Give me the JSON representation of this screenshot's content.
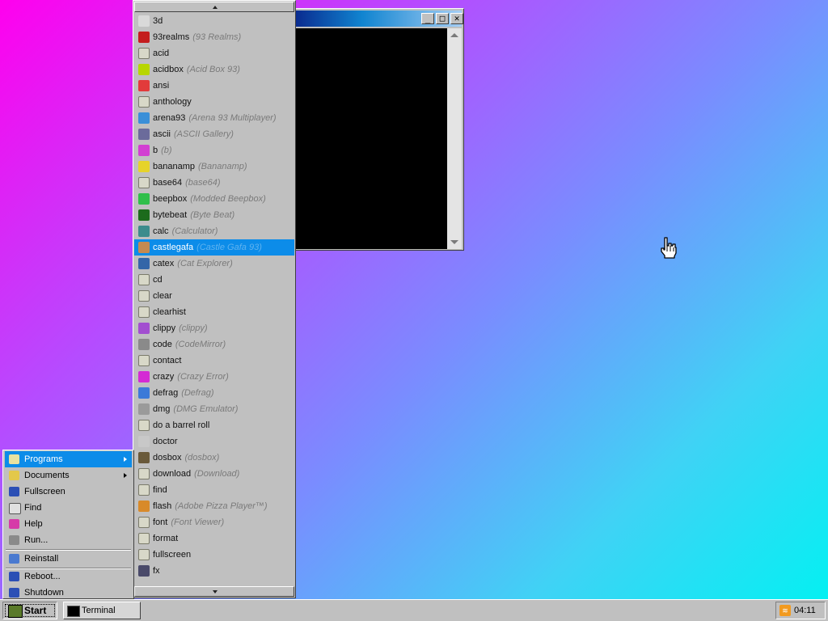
{
  "programs": {
    "selected_index": 14,
    "items": [
      {
        "cmd": "3d",
        "alias": "",
        "icon": "teapot-icon",
        "color": "#d9d9d9"
      },
      {
        "cmd": "93realms",
        "alias": "(93 Realms)",
        "icon": "realms-icon",
        "color": "#c41e1e"
      },
      {
        "cmd": "acid",
        "alias": "",
        "icon": "exe-icon",
        "color": "#d8d8c8"
      },
      {
        "cmd": "acidbox",
        "alias": "(Acid Box 93)",
        "icon": "acid-smiley-icon",
        "color": "#b7d600"
      },
      {
        "cmd": "ansi",
        "alias": "",
        "icon": "ansi-icon",
        "color": "#e23b3b"
      },
      {
        "cmd": "anthology",
        "alias": "",
        "icon": "exe-icon",
        "color": "#d8d8c8"
      },
      {
        "cmd": "arena93",
        "alias": "(Arena 93 Multiplayer)",
        "icon": "cube-icon",
        "color": "#3a8fd8"
      },
      {
        "cmd": "ascii",
        "alias": "(ASCII Gallery)",
        "icon": "ascii-icon",
        "color": "#6b6b9b"
      },
      {
        "cmd": "b",
        "alias": "(b)",
        "icon": "b-icon",
        "color": "#d23fd2"
      },
      {
        "cmd": "bananamp",
        "alias": "(Bananamp)",
        "icon": "banana-icon",
        "color": "#e6d32a"
      },
      {
        "cmd": "base64",
        "alias": "(base64)",
        "icon": "exe-icon",
        "color": "#d8d8c8"
      },
      {
        "cmd": "beepbox",
        "alias": "(Modded Beepbox)",
        "icon": "beepbox-icon",
        "color": "#2fbf4a"
      },
      {
        "cmd": "bytebeat",
        "alias": "(Byte Beat)",
        "icon": "bytebeat-icon",
        "color": "#1c6b1c"
      },
      {
        "cmd": "calc",
        "alias": "(Calculator)",
        "icon": "calculator-icon",
        "color": "#3c8c8c"
      },
      {
        "cmd": "castlegafa",
        "alias": "(Castle Gafa 93)",
        "icon": "castle-character-icon",
        "color": "#c48a52"
      },
      {
        "cmd": "catex",
        "alias": "(Cat Explorer)",
        "icon": "cat-explorer-icon",
        "color": "#3466a8"
      },
      {
        "cmd": "cd",
        "alias": "",
        "icon": "exe-icon",
        "color": "#d8d8c8"
      },
      {
        "cmd": "clear",
        "alias": "",
        "icon": "exe-icon",
        "color": "#d8d8c8"
      },
      {
        "cmd": "clearhist",
        "alias": "",
        "icon": "exe-icon",
        "color": "#d8d8c8"
      },
      {
        "cmd": "clippy",
        "alias": "(clippy)",
        "icon": "clippy-icon",
        "color": "#a24fd0"
      },
      {
        "cmd": "code",
        "alias": "(CodeMirror)",
        "icon": "code-icon",
        "color": "#8a8a8a"
      },
      {
        "cmd": "contact",
        "alias": "",
        "icon": "exe-icon",
        "color": "#d8d8c8"
      },
      {
        "cmd": "crazy",
        "alias": "(Crazy Error)",
        "icon": "error-icon",
        "color": "#d42bd4"
      },
      {
        "cmd": "defrag",
        "alias": "(Defrag)",
        "icon": "defrag-icon",
        "color": "#3c7ad8"
      },
      {
        "cmd": "dmg",
        "alias": "(DMG Emulator)",
        "icon": "gameboy-icon",
        "color": "#9a9a9a"
      },
      {
        "cmd": "do a barrel roll",
        "alias": "",
        "icon": "exe-icon",
        "color": "#d8d8c8"
      },
      {
        "cmd": "doctor",
        "alias": "",
        "icon": "doctor-icon",
        "color": "#c8c8c8"
      },
      {
        "cmd": "dosbox",
        "alias": "(dosbox)",
        "icon": "dosbox-icon",
        "color": "#6a5a3a"
      },
      {
        "cmd": "download",
        "alias": "(Download)",
        "icon": "exe-icon",
        "color": "#d8d8c8"
      },
      {
        "cmd": "find",
        "alias": "",
        "icon": "exe-icon",
        "color": "#d8d8c8"
      },
      {
        "cmd": "flash",
        "alias": "(Adobe Pizza Player™)",
        "icon": "pizza-icon",
        "color": "#d88a2a"
      },
      {
        "cmd": "font",
        "alias": "(Font Viewer)",
        "icon": "exe-icon",
        "color": "#d8d8c8"
      },
      {
        "cmd": "format",
        "alias": "",
        "icon": "exe-icon",
        "color": "#d8d8c8"
      },
      {
        "cmd": "fullscreen",
        "alias": "",
        "icon": "exe-icon",
        "color": "#d8d8c8"
      },
      {
        "cmd": "fx",
        "alias": "",
        "icon": "fx-icon",
        "color": "#4a4a6a"
      }
    ]
  },
  "start_menu": {
    "programs": "Programs",
    "documents": "Documents",
    "fullscreen": "Fullscreen",
    "find": "Find",
    "help": "Help",
    "run": "Run...",
    "reinstall": "Reinstall",
    "reboot": "Reboot...",
    "shutdown": "Shutdown"
  },
  "taskbar": {
    "start_label": "Start",
    "tasks": [
      "Terminal"
    ],
    "clock": "04:11"
  },
  "window": {
    "controls": {
      "minimize": "_",
      "maximize": "□",
      "close": "✕"
    }
  },
  "colors": {
    "selection": "#0c8ce9",
    "face": "#c0c0c0"
  }
}
